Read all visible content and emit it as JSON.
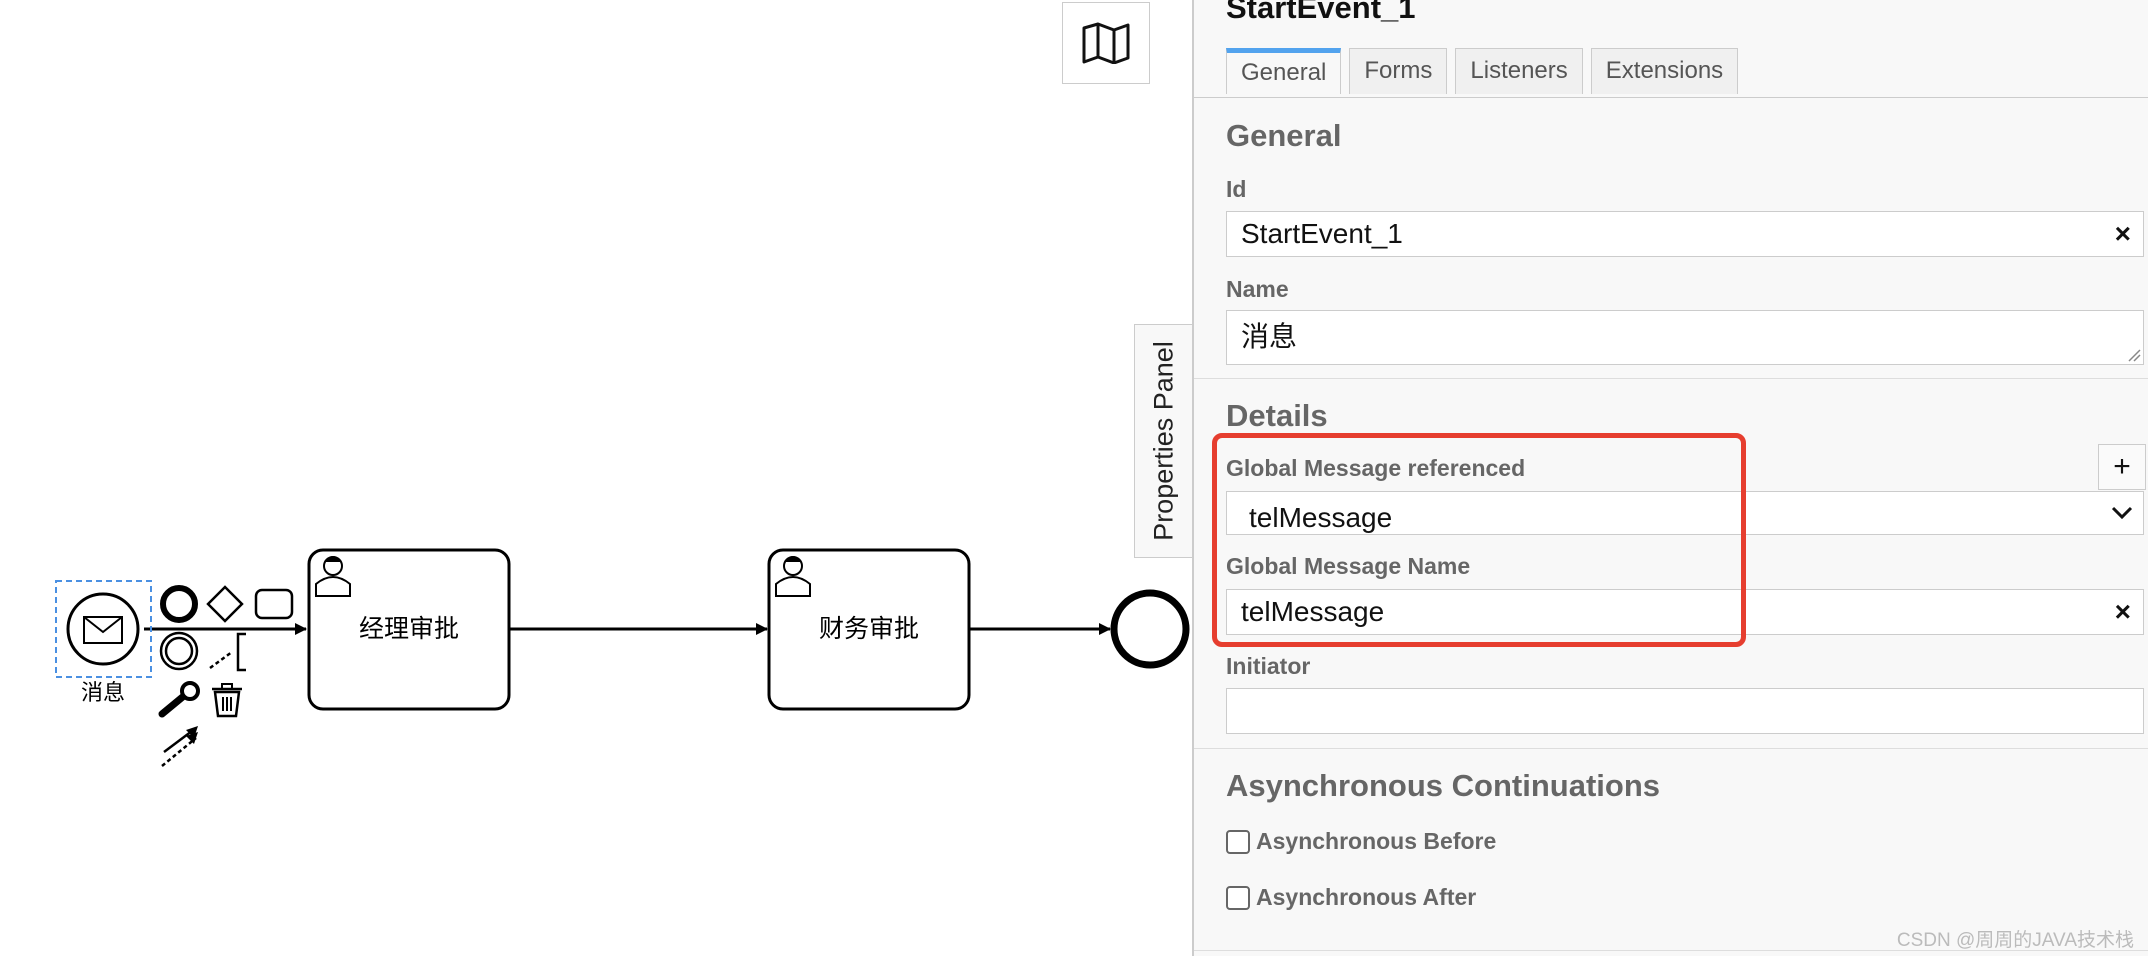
{
  "canvas": {
    "start_event_label": "消息",
    "task1_label": "经理审批",
    "task2_label": "财务审批",
    "map_icon": "map-icon"
  },
  "side_tab": {
    "label": "Properties Panel"
  },
  "panel": {
    "title": "StartEvent_1",
    "tabs": [
      "General",
      "Forms",
      "Listeners",
      "Extensions"
    ],
    "active_tab": "General",
    "general": {
      "heading": "General",
      "id_label": "Id",
      "id_value": "StartEvent_1",
      "name_label": "Name",
      "name_value": "消息"
    },
    "details": {
      "heading": "Details",
      "message_ref_label": "Global Message referenced",
      "message_ref_value": "telMessage",
      "message_name_label": "Global Message Name",
      "message_name_value": "telMessage",
      "initiator_label": "Initiator",
      "initiator_value": ""
    },
    "async": {
      "heading": "Asynchronous Continuations",
      "before_label": "Asynchronous Before",
      "after_label": "Asynchronous After"
    },
    "clear_symbol": "×",
    "add_symbol": "+"
  },
  "watermark": "CSDN @周周的JAVA技术栈",
  "colors": {
    "accent": "#52a3ee",
    "highlight": "#e63e2f",
    "selection": "#4a90e2"
  }
}
